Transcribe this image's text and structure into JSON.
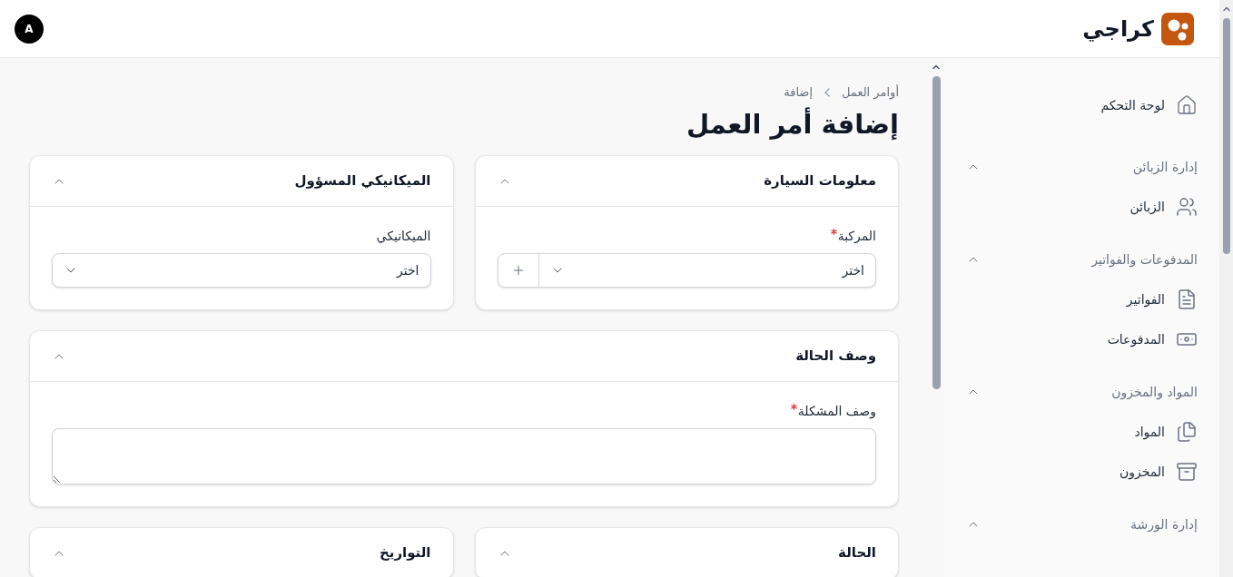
{
  "header": {
    "logo_text": "كراجي",
    "avatar": "A"
  },
  "sidebar": {
    "items": [
      {
        "kind": "link",
        "label": "لوحة التحكم"
      },
      {
        "kind": "group",
        "label": "إدارة الزبائن",
        "expanded": true,
        "children": [
          {
            "label": "الزبائن"
          }
        ]
      },
      {
        "kind": "group",
        "label": "المدفوعات والفواتير",
        "expanded": true,
        "children": [
          {
            "label": "الفواتير"
          },
          {
            "label": "المدفوعات"
          }
        ]
      },
      {
        "kind": "group",
        "label": "المواد والمخزون",
        "expanded": true,
        "children": [
          {
            "label": "المواد"
          },
          {
            "label": "المخزون"
          }
        ]
      },
      {
        "kind": "group",
        "label": "إدارة الورشة",
        "expanded": true
      }
    ]
  },
  "breadcrumb": [
    "أوامر العمل",
    "إضافة"
  ],
  "page_title": "إضافة أمر العمل",
  "rows": [
    [
      {
        "title": "معلومات السيارة",
        "expanded": true,
        "fields": [
          {
            "kind": "select",
            "label": "المركبة",
            "required": true,
            "placeholder": "اختر",
            "add_button": true
          }
        ]
      },
      {
        "title": "الميكانيكي المسؤول",
        "expanded": true,
        "fields": [
          {
            "kind": "select",
            "label": "الميكانيكي",
            "required": false,
            "placeholder": "اختر",
            "add_button": false
          }
        ]
      }
    ],
    [
      {
        "title": "وصف الحالة",
        "expanded": true,
        "fields": [
          {
            "kind": "textarea",
            "label": "وصف المشكلة",
            "required": true
          }
        ]
      }
    ],
    [
      {
        "title": "الحالة",
        "expanded": true
      },
      {
        "title": "التواريخ",
        "expanded": true
      }
    ]
  ]
}
